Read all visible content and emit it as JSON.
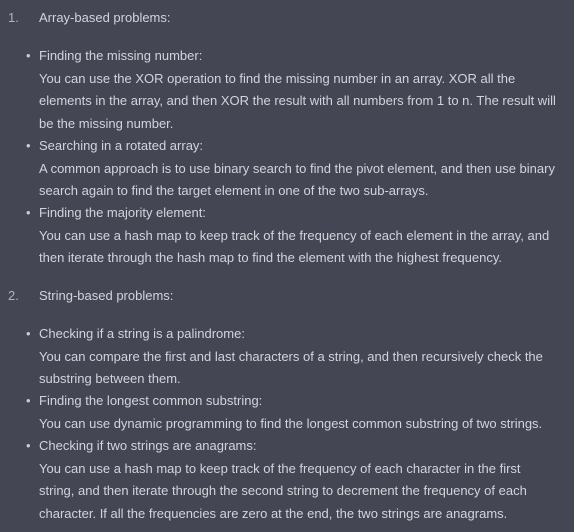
{
  "sections": [
    {
      "number": "1.",
      "title": "Array-based problems:",
      "items": [
        {
          "bullet": "•",
          "title": "Finding the missing number:",
          "body": "You can use the XOR operation to find the missing number in an array. XOR all the elements in the array, and then XOR the result with all numbers from 1 to n. The result will be the missing number."
        },
        {
          "bullet": "•",
          "title": "Searching in a rotated array:",
          "body": "A common approach is to use binary search to find the pivot element, and then use binary search again to find the target element in one of the two sub-arrays."
        },
        {
          "bullet": "•",
          "title": "Finding the majority element:",
          "body": "You can use a hash map to keep track of the frequency of each element in the array, and then iterate through the hash map to find the element with the highest frequency."
        }
      ]
    },
    {
      "number": "2.",
      "title": "String-based problems:",
      "items": [
        {
          "bullet": "•",
          "title": "Checking if a string is a palindrome:",
          "body": "You can compare the first and last characters of a string, and then recursively check the substring between them."
        },
        {
          "bullet": "•",
          "title": "Finding the longest common substring:",
          "body": "You can use dynamic programming to find the longest common substring of two strings."
        },
        {
          "bullet": "•",
          "title": "Checking if two strings are anagrams:",
          "body": "You can use a hash map to keep track of the frequency of each character in the first string, and then iterate through the second string to decrement the frequency of each character. If all the frequencies are zero at the end, the two strings are anagrams."
        }
      ]
    }
  ]
}
